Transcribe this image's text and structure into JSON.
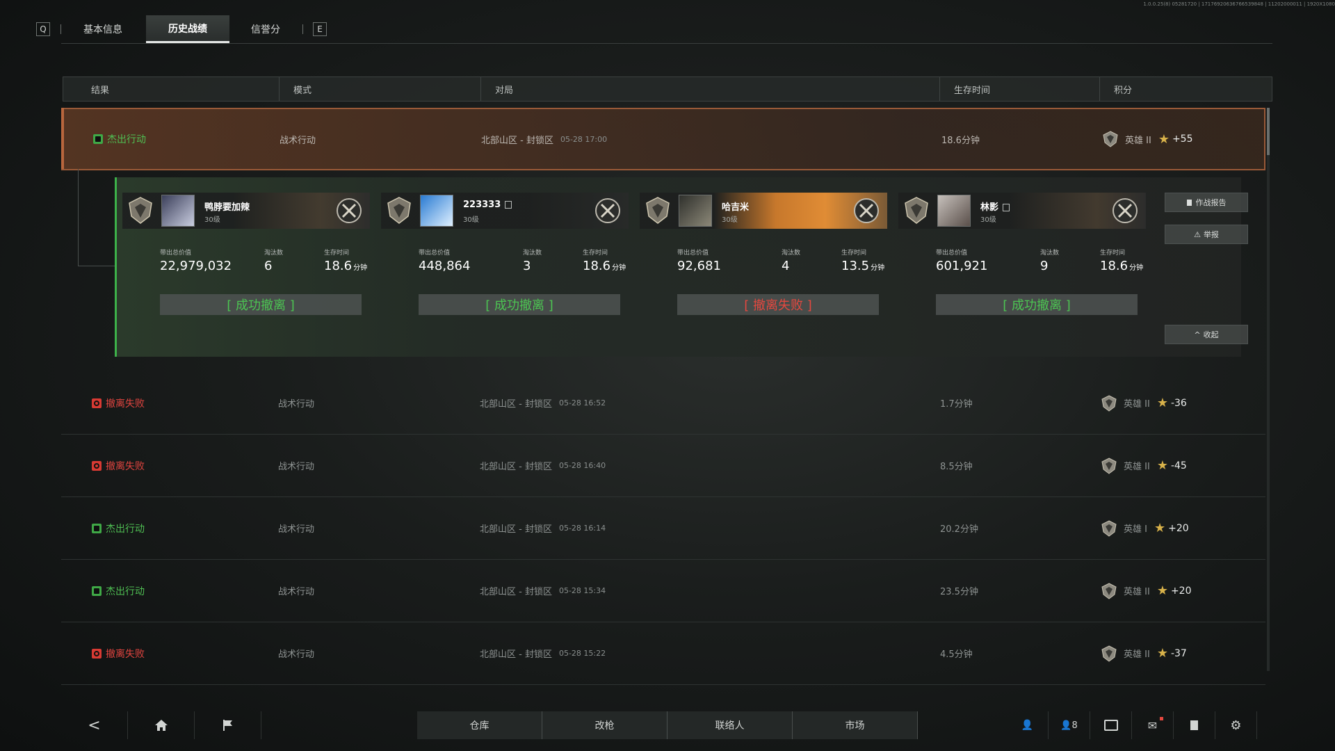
{
  "version": "1.0.0.25(8) 05281720 | 17176920636766539848 | 11202000011 | 1920X1080",
  "top_tabs": {
    "left_key": "Q",
    "right_key": "E",
    "tabs": [
      "基本信息",
      "历史战绩",
      "信誉分"
    ],
    "active": "历史战绩"
  },
  "table": {
    "headers": [
      "结果",
      "模式",
      "对局",
      "生存时间",
      "积分"
    ],
    "rows": [
      {
        "result": "杰出行动",
        "status": "ok",
        "mode": "战术行动",
        "map": "北部山区 - 封锁区",
        "date": "05-28 17:00",
        "time": "18.6分钟",
        "rank": "英雄 II",
        "points": "+55"
      },
      {
        "result": "撤离失败",
        "status": "fail",
        "mode": "战术行动",
        "map": "北部山区 - 封锁区",
        "date": "05-28 16:52",
        "time": "1.7分钟",
        "rank": "英雄 II",
        "points": "-36"
      },
      {
        "result": "撤离失败",
        "status": "fail",
        "mode": "战术行动",
        "map": "北部山区 - 封锁区",
        "date": "05-28 16:40",
        "time": "8.5分钟",
        "rank": "英雄 II",
        "points": "-45"
      },
      {
        "result": "杰出行动",
        "status": "ok",
        "mode": "战术行动",
        "map": "北部山区 - 封锁区",
        "date": "05-28 16:14",
        "time": "20.2分钟",
        "rank": "英雄 I",
        "points": "+20"
      },
      {
        "result": "杰出行动",
        "status": "ok",
        "mode": "战术行动",
        "map": "北部山区 - 封锁区",
        "date": "05-28 15:34",
        "time": "23.5分钟",
        "rank": "英雄 II",
        "points": "+20"
      },
      {
        "result": "撤离失败",
        "status": "fail",
        "mode": "战术行动",
        "map": "北部山区 - 封锁区",
        "date": "05-28 15:22",
        "time": "4.5分钟",
        "rank": "英雄 II",
        "points": "-37"
      }
    ]
  },
  "detail": {
    "stat_labels": {
      "value": "带出总价值",
      "kills": "淘汰数",
      "survive": "生存时间"
    },
    "minute_unit": "分钟",
    "players": [
      {
        "name": "鸭脖要加辣",
        "level": "30级",
        "value": "22,979,032",
        "kills": "6",
        "survive": "18.6",
        "extract": "[ 成功撤离 ]",
        "status": "ok",
        "banner": "dark",
        "copy": false
      },
      {
        "name": "223333",
        "level": "30级",
        "value": "448,864",
        "kills": "3",
        "survive": "18.6",
        "extract": "[ 成功撤离 ]",
        "status": "ok",
        "banner": "plain",
        "copy": true
      },
      {
        "name": "哈吉米",
        "level": "30级",
        "value": "92,681",
        "kills": "4",
        "survive": "13.5",
        "extract": "[ 撤离失败 ]",
        "status": "fail",
        "banner": "orange",
        "copy": false
      },
      {
        "name": "林影",
        "level": "30级",
        "value": "601,921",
        "kills": "9",
        "survive": "18.6",
        "extract": "[ 成功撤离 ]",
        "status": "ok",
        "banner": "dark",
        "copy": true
      }
    ],
    "side_buttons": {
      "report": "作战报告",
      "tip_off": "举报",
      "collapse": "收起"
    }
  },
  "bottom_nav": {
    "items": [
      "仓库",
      "改枪",
      "联络人",
      "市场"
    ],
    "friends_count": "8"
  },
  "colors": {
    "ok": "#4cc552",
    "fail": "#e5483f",
    "accent": "#b8663d",
    "star": "#d8b24a"
  }
}
